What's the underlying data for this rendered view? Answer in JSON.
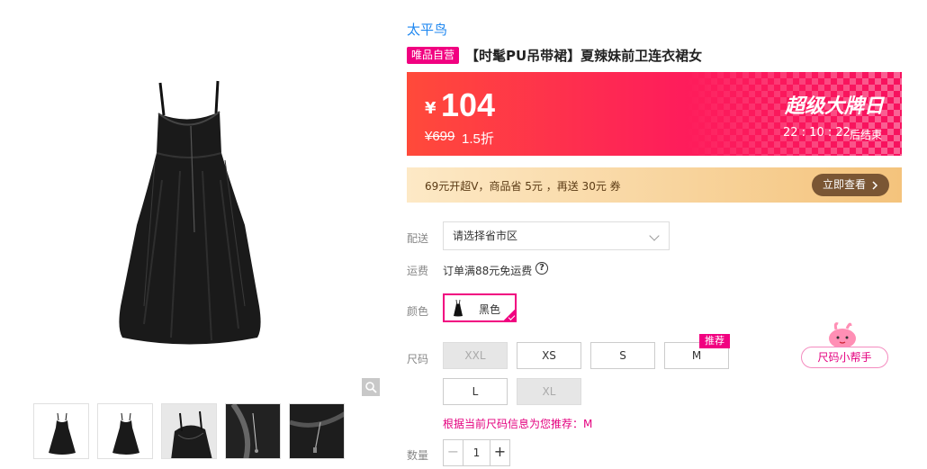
{
  "brand": "太平鸟",
  "badge": "唯品自营",
  "title": "【时髦PU吊带裙】夏辣妹前卫连衣裙女",
  "price_banner": {
    "currency": "¥",
    "price": "104",
    "original_price": "¥699",
    "discount": "1.5折",
    "event_name": "超级大牌日",
    "countdown": "22 : 10 : 22",
    "countdown_suffix": "后结束"
  },
  "vip_bar": {
    "text": "69元开超V，商品省 5元 ，再送 30元 券",
    "button_label": "立即查看"
  },
  "delivery": {
    "label": "配送",
    "placeholder": "请选择省市区"
  },
  "shipping": {
    "label": "运费",
    "text": "订单满88元免运费",
    "help_glyph": "?"
  },
  "color": {
    "label": "颜色",
    "selected": "黑色"
  },
  "size": {
    "label": "尺码",
    "options": [
      {
        "label": "XXL",
        "available": false
      },
      {
        "label": "XS",
        "available": true
      },
      {
        "label": "S",
        "available": true
      },
      {
        "label": "M",
        "available": true
      },
      {
        "label": "L",
        "available": true
      },
      {
        "label": "XL",
        "available": false
      }
    ],
    "recommend_tag": "推荐",
    "recommend_text": "根据当前尺码信息为您推荐：M",
    "helper_button": "尺码小帮手"
  },
  "quantity": {
    "label": "数量",
    "value": "1",
    "minus": "−",
    "plus": "+"
  },
  "colors": {
    "accent": "#f10180",
    "link": "#1e87f0",
    "banner": "#fe1d5b"
  },
  "icons": [
    "zoom-icon",
    "chevron-down-icon",
    "help-icon",
    "chevron-right-icon",
    "check-icon",
    "mascot-icon"
  ]
}
